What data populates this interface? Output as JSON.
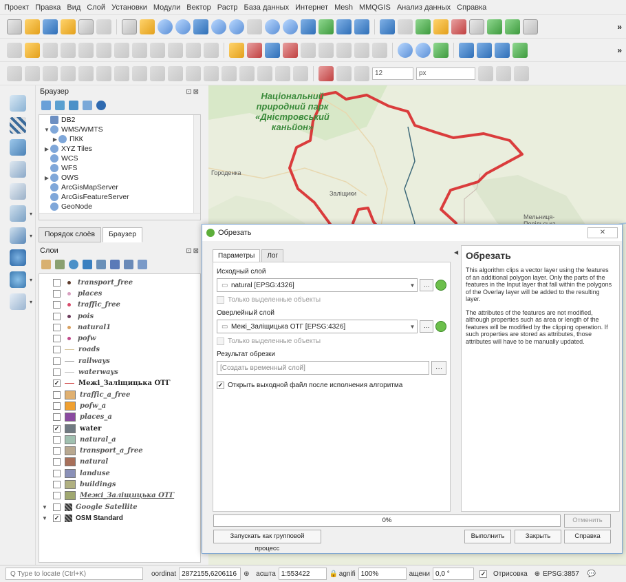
{
  "menu": [
    "Проект",
    "Правка",
    "Вид",
    "Слой",
    "Установки",
    "Модули",
    "Вектор",
    "Растр",
    "База данных",
    "Интернет",
    "Mesh",
    "MMQGIS",
    "Анализ данных",
    "Справка"
  ],
  "toolbar3": {
    "size_value": "12",
    "unit_value": "px"
  },
  "browser": {
    "title": "Браузер",
    "items": [
      {
        "label": "DB2",
        "arrow": ""
      },
      {
        "label": "WMS/WMTS",
        "arrow": "▼"
      },
      {
        "label": "ПКК",
        "arrow": "▶"
      },
      {
        "label": "XYZ Tiles",
        "arrow": "▶"
      },
      {
        "label": "WCS",
        "arrow": ""
      },
      {
        "label": "WFS",
        "arrow": ""
      },
      {
        "label": "OWS",
        "arrow": "▶"
      },
      {
        "label": "ArcGisMapServer",
        "arrow": ""
      },
      {
        "label": "ArcGisFeatureServer",
        "arrow": ""
      },
      {
        "label": "GeoNode",
        "arrow": ""
      }
    ]
  },
  "panel_tabs": {
    "layer_order": "Порядок слоёв",
    "browser": "Браузер"
  },
  "layers": {
    "title": "Слои",
    "items": [
      {
        "name": "transport_free",
        "checked": false,
        "sym": "dot",
        "color": "#5c3a2a"
      },
      {
        "name": "places",
        "checked": false,
        "sym": "dot",
        "color": "#d8a0c0"
      },
      {
        "name": "traffic_free",
        "checked": false,
        "sym": "dot",
        "color": "#d84a6a"
      },
      {
        "name": "pois",
        "checked": false,
        "sym": "dot",
        "color": "#6a3a5a"
      },
      {
        "name": "natural1",
        "checked": false,
        "sym": "dot",
        "color": "#d8a060"
      },
      {
        "name": "pofw",
        "checked": false,
        "sym": "dot",
        "color": "#c04a8a"
      },
      {
        "name": "roads",
        "checked": false,
        "sym": "line",
        "color": "#d8c8a0"
      },
      {
        "name": "railways",
        "checked": false,
        "sym": "line",
        "color": "#999999"
      },
      {
        "name": "waterways",
        "checked": false,
        "sym": "line",
        "color": "#c0c0c0"
      },
      {
        "name": "Межі_Заліщицька ОТГ",
        "checked": true,
        "sym": "line",
        "color": "#cc3333",
        "on": true
      },
      {
        "name": "traffic_a_free",
        "checked": false,
        "sym": "box",
        "color": "#e0b070"
      },
      {
        "name": "pofw_a",
        "checked": false,
        "sym": "box",
        "color": "#f0a030"
      },
      {
        "name": "places_a",
        "checked": false,
        "sym": "box",
        "color": "#8a4aa0"
      },
      {
        "name": "water",
        "checked": true,
        "sym": "box",
        "color": "#707a82",
        "on": true
      },
      {
        "name": "natural_a",
        "checked": false,
        "sym": "box",
        "color": "#a0c0b0"
      },
      {
        "name": "transport_a_free",
        "checked": false,
        "sym": "box",
        "color": "#b8a890"
      },
      {
        "name": "natural",
        "checked": false,
        "sym": "box",
        "color": "#a8705a"
      },
      {
        "name": "landuse",
        "checked": false,
        "sym": "box",
        "color": "#8a90b8"
      },
      {
        "name": "buildings",
        "checked": false,
        "sym": "box",
        "color": "#b0b080"
      },
      {
        "name": "Межі_Заліщицька ОТГ",
        "checked": false,
        "sym": "box",
        "color": "#a0a870",
        "underline": true
      }
    ],
    "groups": [
      {
        "name": "Google Satellite",
        "checked": false
      },
      {
        "name": "OSM Standard",
        "checked": true
      }
    ]
  },
  "map": {
    "park_label": "Національний природний парк «Дністровський каньйон»",
    "town1": "Городенка",
    "town2": "Заліщики",
    "town3": "Мельниця-Подільська"
  },
  "dialog": {
    "title": "Обрезать",
    "tabs": [
      "Параметры",
      "Лог"
    ],
    "input_label": "Исходный слой",
    "input_value": "natural [EPSG:4326]",
    "selected_only": "Только выделенные объекты",
    "overlay_label": "Оверлейный слой",
    "overlay_value": "Межі_Заліщицька ОТГ [EPSG:4326]",
    "selected_only2": "Только выделенные объекты",
    "result_label": "Результат обрезки",
    "result_placeholder": "[Создать временный слой]",
    "open_output": "Открыть выходной файл после исполнения алгоритма",
    "help_title": "Обрезать",
    "help_p1": "This algorithm clips a vector layer using the features of an additional polygon layer. Only the parts of the features in the Input layer that fall within the polygons of the Overlay layer will be added to the resulting layer.",
    "help_p2": "The attributes of the features are not modified, although properties such as area or length of the features will be modified by the clipping operation. If such properties are stored as attributes, those attributes will have to be manually updated.",
    "progress": "0%",
    "cancel": "Отменить",
    "batch": "Запускать как групповой процесс",
    "run": "Выполнить",
    "close": "Закрыть",
    "help": "Справка"
  },
  "statusbar": {
    "locator": "Q  Type to locate (Ctrl+K)",
    "coord_label": "оordinat",
    "coord_value": "2872155,6206116",
    "scale_label": "асшта",
    "scale_value": "1:553422",
    "magnifier_label": "agnifi",
    "magnifier_value": "100%",
    "rotation_label": "ащени",
    "rotation_value": "0,0 °",
    "render": "Отрисовка",
    "crs": "EPSG:3857"
  }
}
